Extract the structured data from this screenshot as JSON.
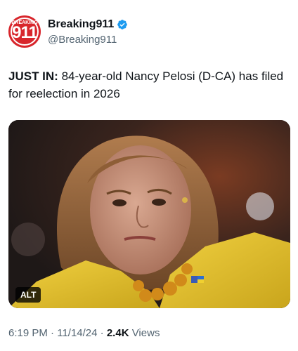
{
  "author": {
    "avatar_top_text": "BREAKING",
    "avatar_big_text": "911",
    "display_name": "Breaking911",
    "handle": "@Breaking911",
    "verified_icon": "verified-badge-icon",
    "brand_color": "#d8262c",
    "verified_color": "#1d9bf0"
  },
  "tweet": {
    "prefix": "JUST IN:",
    "body": " 84-year-old Nancy Pelosi (D-CA) has filed for reelection in 2026"
  },
  "media": {
    "alt_label": "ALT"
  },
  "meta": {
    "time": "6:19 PM",
    "sep1": " · ",
    "date": "11/14/24",
    "sep2": " · ",
    "views_count": "2.4K",
    "views_label": " Views"
  }
}
